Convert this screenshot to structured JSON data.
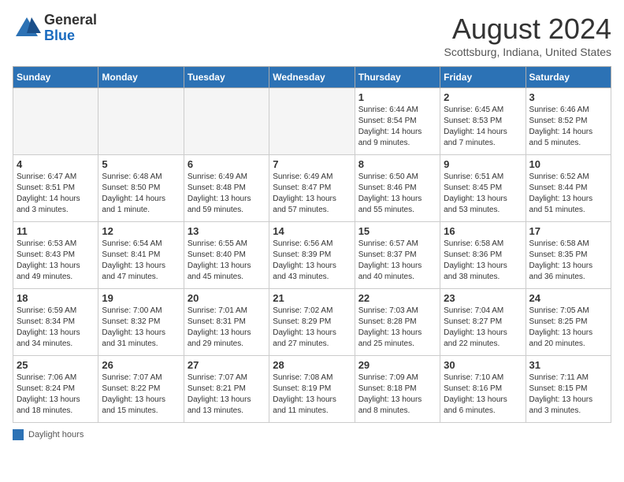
{
  "header": {
    "logo_general": "General",
    "logo_blue": "Blue",
    "month_title": "August 2024",
    "subtitle": "Scottsburg, Indiana, United States"
  },
  "days_of_week": [
    "Sunday",
    "Monday",
    "Tuesday",
    "Wednesday",
    "Thursday",
    "Friday",
    "Saturday"
  ],
  "weeks": [
    [
      {
        "day": "",
        "info": ""
      },
      {
        "day": "",
        "info": ""
      },
      {
        "day": "",
        "info": ""
      },
      {
        "day": "",
        "info": ""
      },
      {
        "day": "1",
        "info": "Sunrise: 6:44 AM\nSunset: 8:54 PM\nDaylight: 14 hours and 9 minutes."
      },
      {
        "day": "2",
        "info": "Sunrise: 6:45 AM\nSunset: 8:53 PM\nDaylight: 14 hours and 7 minutes."
      },
      {
        "day": "3",
        "info": "Sunrise: 6:46 AM\nSunset: 8:52 PM\nDaylight: 14 hours and 5 minutes."
      }
    ],
    [
      {
        "day": "4",
        "info": "Sunrise: 6:47 AM\nSunset: 8:51 PM\nDaylight: 14 hours and 3 minutes."
      },
      {
        "day": "5",
        "info": "Sunrise: 6:48 AM\nSunset: 8:50 PM\nDaylight: 14 hours and 1 minute."
      },
      {
        "day": "6",
        "info": "Sunrise: 6:49 AM\nSunset: 8:48 PM\nDaylight: 13 hours and 59 minutes."
      },
      {
        "day": "7",
        "info": "Sunrise: 6:49 AM\nSunset: 8:47 PM\nDaylight: 13 hours and 57 minutes."
      },
      {
        "day": "8",
        "info": "Sunrise: 6:50 AM\nSunset: 8:46 PM\nDaylight: 13 hours and 55 minutes."
      },
      {
        "day": "9",
        "info": "Sunrise: 6:51 AM\nSunset: 8:45 PM\nDaylight: 13 hours and 53 minutes."
      },
      {
        "day": "10",
        "info": "Sunrise: 6:52 AM\nSunset: 8:44 PM\nDaylight: 13 hours and 51 minutes."
      }
    ],
    [
      {
        "day": "11",
        "info": "Sunrise: 6:53 AM\nSunset: 8:43 PM\nDaylight: 13 hours and 49 minutes."
      },
      {
        "day": "12",
        "info": "Sunrise: 6:54 AM\nSunset: 8:41 PM\nDaylight: 13 hours and 47 minutes."
      },
      {
        "day": "13",
        "info": "Sunrise: 6:55 AM\nSunset: 8:40 PM\nDaylight: 13 hours and 45 minutes."
      },
      {
        "day": "14",
        "info": "Sunrise: 6:56 AM\nSunset: 8:39 PM\nDaylight: 13 hours and 43 minutes."
      },
      {
        "day": "15",
        "info": "Sunrise: 6:57 AM\nSunset: 8:37 PM\nDaylight: 13 hours and 40 minutes."
      },
      {
        "day": "16",
        "info": "Sunrise: 6:58 AM\nSunset: 8:36 PM\nDaylight: 13 hours and 38 minutes."
      },
      {
        "day": "17",
        "info": "Sunrise: 6:58 AM\nSunset: 8:35 PM\nDaylight: 13 hours and 36 minutes."
      }
    ],
    [
      {
        "day": "18",
        "info": "Sunrise: 6:59 AM\nSunset: 8:34 PM\nDaylight: 13 hours and 34 minutes."
      },
      {
        "day": "19",
        "info": "Sunrise: 7:00 AM\nSunset: 8:32 PM\nDaylight: 13 hours and 31 minutes."
      },
      {
        "day": "20",
        "info": "Sunrise: 7:01 AM\nSunset: 8:31 PM\nDaylight: 13 hours and 29 minutes."
      },
      {
        "day": "21",
        "info": "Sunrise: 7:02 AM\nSunset: 8:29 PM\nDaylight: 13 hours and 27 minutes."
      },
      {
        "day": "22",
        "info": "Sunrise: 7:03 AM\nSunset: 8:28 PM\nDaylight: 13 hours and 25 minutes."
      },
      {
        "day": "23",
        "info": "Sunrise: 7:04 AM\nSunset: 8:27 PM\nDaylight: 13 hours and 22 minutes."
      },
      {
        "day": "24",
        "info": "Sunrise: 7:05 AM\nSunset: 8:25 PM\nDaylight: 13 hours and 20 minutes."
      }
    ],
    [
      {
        "day": "25",
        "info": "Sunrise: 7:06 AM\nSunset: 8:24 PM\nDaylight: 13 hours and 18 minutes."
      },
      {
        "day": "26",
        "info": "Sunrise: 7:07 AM\nSunset: 8:22 PM\nDaylight: 13 hours and 15 minutes."
      },
      {
        "day": "27",
        "info": "Sunrise: 7:07 AM\nSunset: 8:21 PM\nDaylight: 13 hours and 13 minutes."
      },
      {
        "day": "28",
        "info": "Sunrise: 7:08 AM\nSunset: 8:19 PM\nDaylight: 13 hours and 11 minutes."
      },
      {
        "day": "29",
        "info": "Sunrise: 7:09 AM\nSunset: 8:18 PM\nDaylight: 13 hours and 8 minutes."
      },
      {
        "day": "30",
        "info": "Sunrise: 7:10 AM\nSunset: 8:16 PM\nDaylight: 13 hours and 6 minutes."
      },
      {
        "day": "31",
        "info": "Sunrise: 7:11 AM\nSunset: 8:15 PM\nDaylight: 13 hours and 3 minutes."
      }
    ]
  ],
  "footer": {
    "legend_label": "Daylight hours"
  }
}
